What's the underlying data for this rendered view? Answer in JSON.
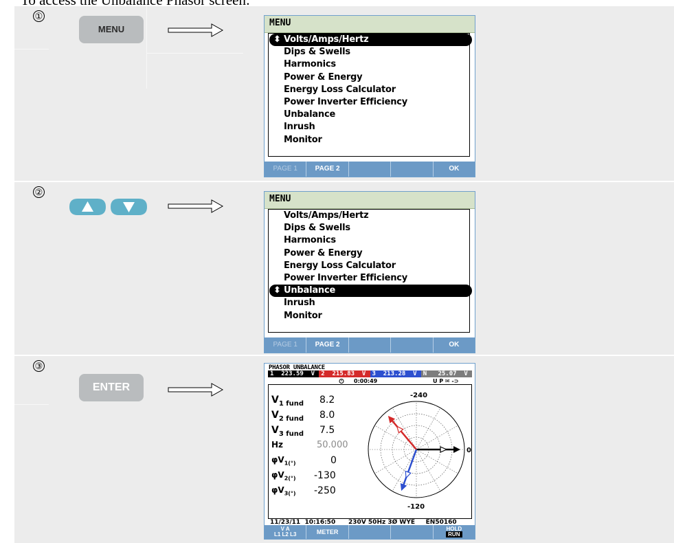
{
  "heading": "To access the Unbalance Phasor screen:",
  "steps": [
    {
      "number": "①",
      "key_label": "MENU"
    },
    {
      "number": "②"
    },
    {
      "number": "③",
      "key_label": "ENTER"
    }
  ],
  "icons": {
    "flow_arrow": "right-arrow-icon",
    "up_key": "up-arrow-key-icon",
    "down_key": "down-arrow-key-icon",
    "selection_marker": "up-down-arrows-icon"
  },
  "colors": {
    "panel": "#ececec",
    "arrow_key": "#5fb0c8",
    "menu_title_bar": "#d6e2c9",
    "softkey_bar": "#6c9ac6",
    "phase1": "#000000",
    "phase2": "#d42a2a",
    "phase3": "#2d4fcf"
  },
  "menu": {
    "title": "MENU",
    "selection_marker": "⬍",
    "items": [
      "Volts/Amps/Hertz",
      "Dips & Swells",
      "Harmonics",
      "Power & Energy",
      "Energy Loss Calculator",
      "Power Inverter Efficiency",
      "Unbalance",
      "Inrush",
      "Monitor"
    ],
    "softkeys": [
      "PAGE 1",
      "PAGE 2",
      "",
      "",
      "OK"
    ]
  },
  "phasor": {
    "title": "PHASOR UNBALANCE",
    "channels": [
      {
        "num": "1",
        "value": "223.59",
        "unit": "V"
      },
      {
        "num": "2",
        "value": "215.83",
        "unit": "V"
      },
      {
        "num": "3",
        "value": "213.28",
        "unit": "V"
      },
      {
        "num": "N",
        "value": "25.07",
        "unit": "V"
      }
    ],
    "clock_icon": "timer-icon",
    "elapsed": "0:00:49",
    "status_icons": "U P ✉ -⊃",
    "readings": [
      {
        "label": "V",
        "sub": "1 fund",
        "value": "8.2"
      },
      {
        "label": "V",
        "sub": "2 fund",
        "value": "8.0"
      },
      {
        "label": "V",
        "sub": "3 fund",
        "value": "7.5"
      },
      {
        "label": "Hz",
        "sub": "",
        "value": "50.000"
      },
      {
        "label": "φV",
        "sub": "1(°)",
        "value": "0"
      },
      {
        "label": "φV",
        "sub": "2(°)",
        "value": "-130"
      },
      {
        "label": "φV",
        "sub": "3(°)",
        "value": "-250"
      }
    ],
    "polar_labels": {
      "top": "-240",
      "right": "0",
      "bottom": "-120"
    },
    "phasors": [
      {
        "phase": "V1",
        "angle_deg": 0,
        "color": "#000000"
      },
      {
        "phase": "V2",
        "angle_deg": -130,
        "color": "#d42a2a"
      },
      {
        "phase": "V3",
        "angle_deg": -250,
        "color": "#2d4fcf"
      }
    ],
    "footer": {
      "date": "11/23/11",
      "time": "10:16:50",
      "config": "230V  50Hz 3Ø WYE",
      "standard": "EN50160"
    },
    "softkeys": [
      {
        "line1": "V  A",
        "line2": "L1 L2 L3"
      },
      {
        "line1": "METER",
        "line2": ""
      },
      {
        "line1": "",
        "line2": ""
      },
      {
        "line1": "",
        "line2": ""
      },
      {
        "line1": "HOLD",
        "line2": "RUN"
      }
    ]
  }
}
